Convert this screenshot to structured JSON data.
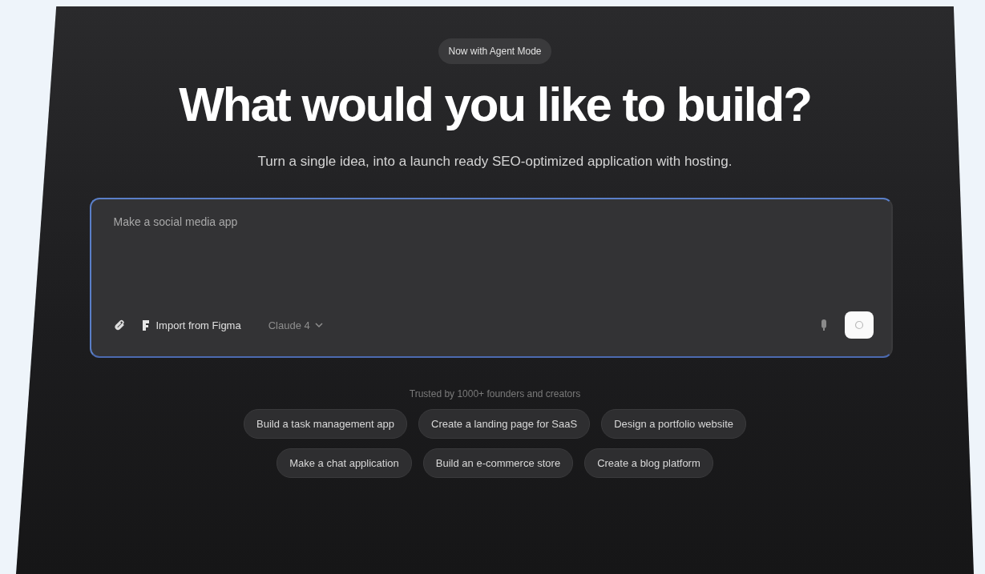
{
  "badge": "Now with Agent Mode",
  "heading": "What would you like to build?",
  "subtitle": "Turn a single idea, into a launch ready SEO-optimized application with hosting.",
  "prompt": {
    "placeholder": "Make a social media app",
    "import_label": "Import from Figma",
    "model": "Claude 4"
  },
  "trusted": "Trusted by 1000+ founders and creators",
  "suggestion_rows": [
    [
      "Build a task management app",
      "Create a landing page for SaaS",
      "Design a portfolio website"
    ],
    [
      "Make a chat application",
      "Build an e-commerce store",
      "Create a blog platform"
    ]
  ]
}
